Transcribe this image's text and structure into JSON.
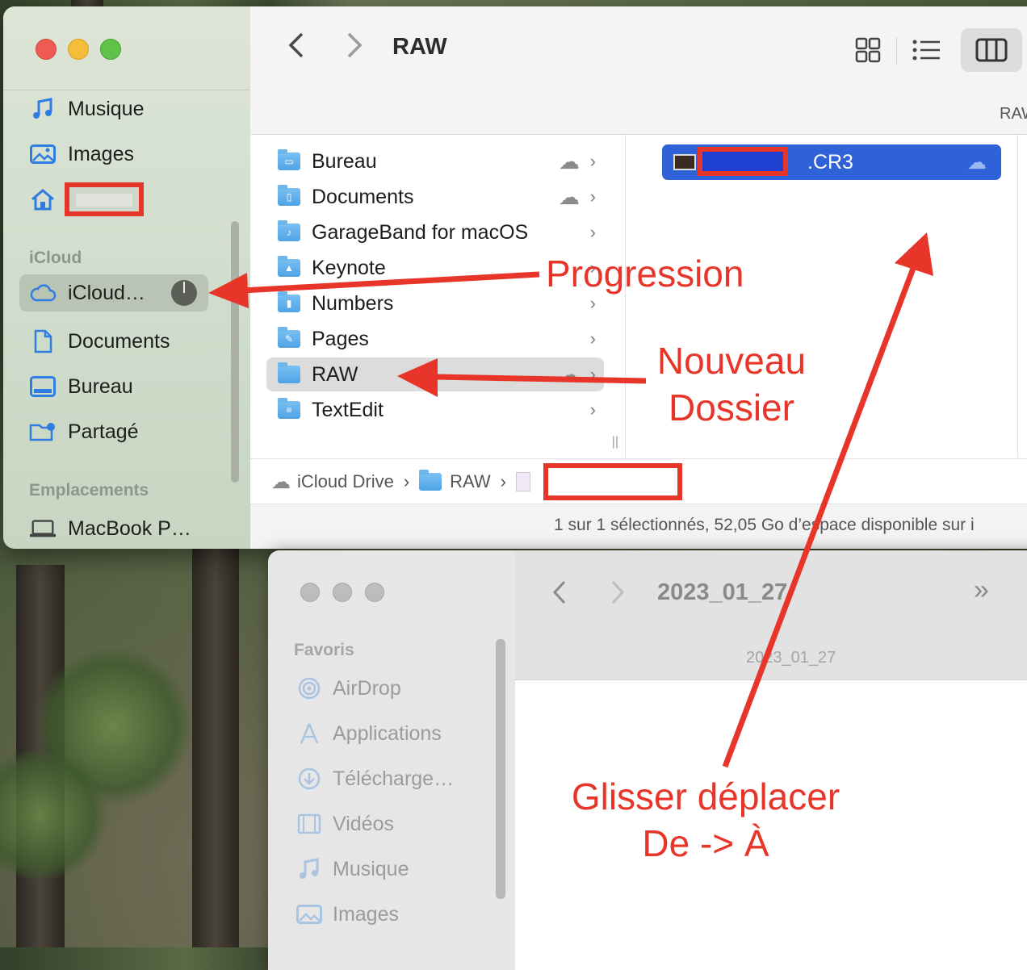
{
  "front_window": {
    "title": "RAW",
    "path_header": "RAW",
    "sidebar": {
      "items_top": [
        {
          "label": "Musique",
          "icon": "music-note-icon"
        },
        {
          "label": "Images",
          "icon": "photo-icon"
        },
        {
          "label": "",
          "icon": "home-icon"
        }
      ],
      "section_icloud": "iCloud",
      "icloud_items": [
        {
          "label": "iCloud…",
          "icon": "cloud-icon"
        },
        {
          "label": "Documents",
          "icon": "document-icon"
        },
        {
          "label": "Bureau",
          "icon": "desktop-icon"
        },
        {
          "label": "Partagé",
          "icon": "shared-folder-icon"
        }
      ],
      "section_locations": "Emplacements",
      "location_items": [
        {
          "label": "MacBook P…",
          "icon": "laptop-icon"
        }
      ]
    },
    "column1": [
      {
        "label": "Bureau",
        "cloud": true
      },
      {
        "label": "Documents",
        "cloud": true
      },
      {
        "label": "GarageBand for macOS",
        "cloud": false
      },
      {
        "label": "Keynote",
        "cloud": false
      },
      {
        "label": "Numbers",
        "cloud": false
      },
      {
        "label": "Pages",
        "cloud": false
      },
      {
        "label": "RAW",
        "cloud": true
      },
      {
        "label": "TextEdit",
        "cloud": false
      }
    ],
    "column2_file": ".CR3",
    "pathbar": {
      "root": "iCloud Drive",
      "folder": "RAW"
    },
    "status": "1 sur 1 sélectionnés, 52,05 Go d’espace disponible sur i"
  },
  "back_window": {
    "title": "2023_01_27",
    "path_header": "2023_01_27",
    "section_favorites": "Favoris",
    "favorites": [
      {
        "label": "AirDrop",
        "icon": "airdrop-icon"
      },
      {
        "label": "Applications",
        "icon": "applications-icon"
      },
      {
        "label": "Télécharge…",
        "icon": "download-icon"
      },
      {
        "label": "Vidéos",
        "icon": "film-icon"
      },
      {
        "label": "Musique",
        "icon": "music-note-icon"
      },
      {
        "label": "Images",
        "icon": "photo-icon"
      }
    ]
  },
  "annotations": {
    "progression": "Progression",
    "nouveau_line1": "Nouveau",
    "nouveau_line2": "Dossier",
    "glisser_line1": "Glisser déplacer",
    "glisser_line2": "De -> À"
  },
  "colors": {
    "annotation": "#e8352a",
    "selection": "#2f62d8"
  }
}
